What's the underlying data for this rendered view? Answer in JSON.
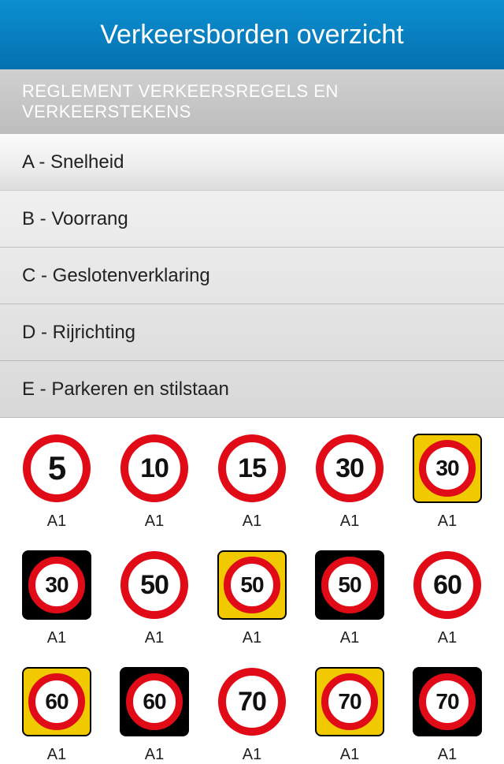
{
  "header": {
    "title": "Verkeersborden overzicht"
  },
  "section": {
    "title": "REGLEMENT VERKEERSREGELS EN VERKEERSTEKENS"
  },
  "categories": [
    {
      "label": "A - Snelheid"
    },
    {
      "label": "B - Voorrang"
    },
    {
      "label": "C - Geslotenverklaring"
    },
    {
      "label": "D - Rijrichting"
    },
    {
      "label": "E - Parkeren en stilstaan"
    }
  ],
  "signs": [
    {
      "speed": "5",
      "label": "A1",
      "plate": "none"
    },
    {
      "speed": "10",
      "label": "A1",
      "plate": "none"
    },
    {
      "speed": "15",
      "label": "A1",
      "plate": "none"
    },
    {
      "speed": "30",
      "label": "A1",
      "plate": "none"
    },
    {
      "speed": "30",
      "label": "A1",
      "plate": "yellow"
    },
    {
      "speed": "30",
      "label": "A1",
      "plate": "black"
    },
    {
      "speed": "50",
      "label": "A1",
      "plate": "none"
    },
    {
      "speed": "50",
      "label": "A1",
      "plate": "yellow"
    },
    {
      "speed": "50",
      "label": "A1",
      "plate": "black"
    },
    {
      "speed": "60",
      "label": "A1",
      "plate": "none"
    },
    {
      "speed": "60",
      "label": "A1",
      "plate": "yellow"
    },
    {
      "speed": "60",
      "label": "A1",
      "plate": "black"
    },
    {
      "speed": "70",
      "label": "A1",
      "plate": "none"
    },
    {
      "speed": "70",
      "label": "A1",
      "plate": "yellow"
    },
    {
      "speed": "70",
      "label": "A1",
      "plate": "black"
    }
  ]
}
